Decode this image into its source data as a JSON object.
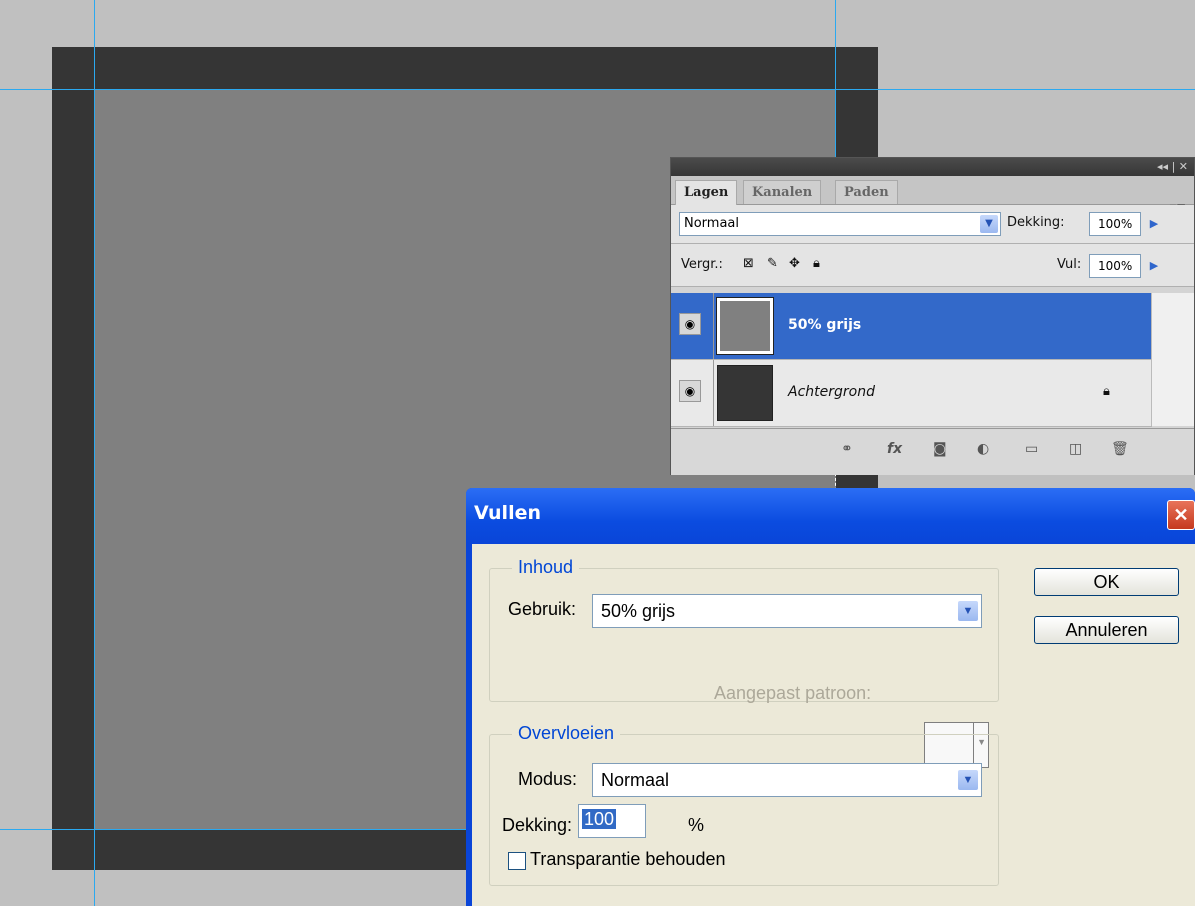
{
  "layers_panel": {
    "tabs": [
      "Lagen",
      "Kanalen",
      "Paden"
    ],
    "blend_mode": "Normaal",
    "opacity_label": "Dekking:",
    "opacity_value": "100%",
    "lock_label": "Vergr.:",
    "fill_label": "Vul:",
    "fill_value": "100%",
    "layers": [
      {
        "name": "50% grijs",
        "selected": true
      },
      {
        "name": "Achtergrond",
        "selected": false,
        "locked": true
      }
    ]
  },
  "dialog": {
    "title": "Vullen",
    "contents_group": "Inhoud",
    "use_label": "Gebruik:",
    "use_value": "50% grijs",
    "custom_pattern_label": "Aangepast patroon:",
    "blending_group": "Overvloeien",
    "mode_label": "Modus:",
    "mode_value": "Normaal",
    "opacity_label": "Dekking:",
    "opacity_value": "100",
    "percent_sign": "%",
    "preserve_transparency_label": "Transparantie behouden",
    "ok_label": "OK",
    "cancel_label": "Annuleren"
  },
  "colors": {
    "accent": "#316ac5",
    "title_blue": "#0a45d8",
    "canvas_gray": "#808080",
    "canvas_dark": "#353535",
    "guide_blue": "#2ba9f0"
  }
}
